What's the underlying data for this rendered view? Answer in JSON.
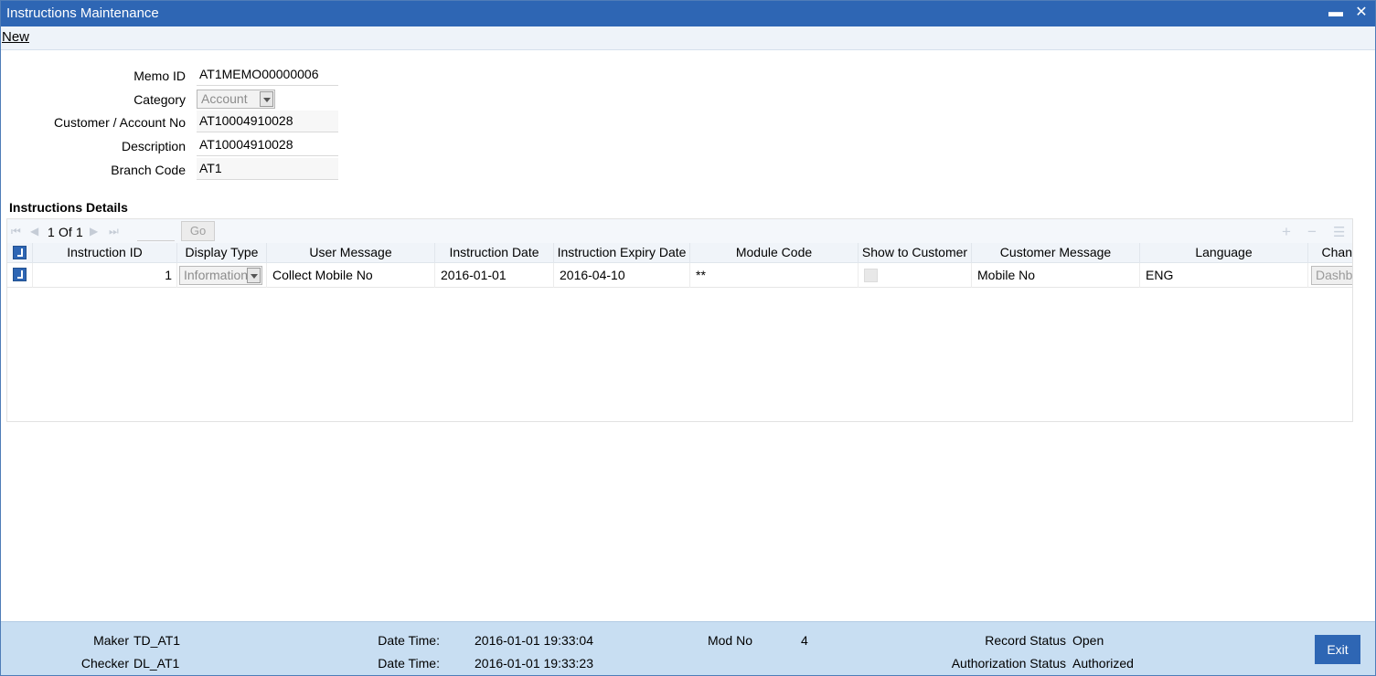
{
  "window": {
    "title": "Instructions Maintenance",
    "minimize_glyph": "▬",
    "close_glyph": "✕"
  },
  "toolbar": {
    "new_label": "New"
  },
  "form": {
    "memo_id_label": "Memo ID",
    "memo_id_value": "AT1MEMO00000006",
    "category_label": "Category",
    "category_value": "Account",
    "account_label": "Customer / Account No",
    "account_value": "AT10004910028",
    "description_label": "Description",
    "description_value": "AT10004910028",
    "branch_label": "Branch Code",
    "branch_value": "AT1"
  },
  "details": {
    "title": "Instructions Details",
    "pager": {
      "current": "1",
      "of_label": "Of",
      "total": "1",
      "go_label": "Go"
    },
    "columns": [
      "Instruction ID",
      "Display Type",
      "User Message",
      "Instruction Date",
      "Instruction Expiry Date",
      "Module Code",
      "Show to Customer",
      "Customer Message",
      "Language",
      "Chan"
    ],
    "rows": [
      {
        "instruction_id": "1",
        "display_type": "Information",
        "user_message": "Collect Mobile No",
        "instruction_date": "2016-01-01",
        "expiry_date": "2016-04-10",
        "module_code": "**",
        "customer_message": "Mobile No",
        "language": "ENG",
        "channel": "Dashbo"
      }
    ]
  },
  "footer": {
    "maker_label": "Maker",
    "maker_value": "TD_AT1",
    "checker_label": "Checker",
    "checker_value": "DL_AT1",
    "dt_label_1": "Date Time:",
    "dt_value_1": "2016-01-01 19:33:04",
    "dt_label_2": "Date Time:",
    "dt_value_2": "2016-01-01 19:33:23",
    "mod_label": "Mod No",
    "mod_value": "4",
    "record_label": "Record Status",
    "record_value": "Open",
    "auth_label": "Authorization Status",
    "auth_value": "Authorized",
    "exit_label": "Exit"
  },
  "colors": {
    "titlebar": "#2e66b4",
    "footer": "#c8def2",
    "accent": "#2e66b4"
  }
}
